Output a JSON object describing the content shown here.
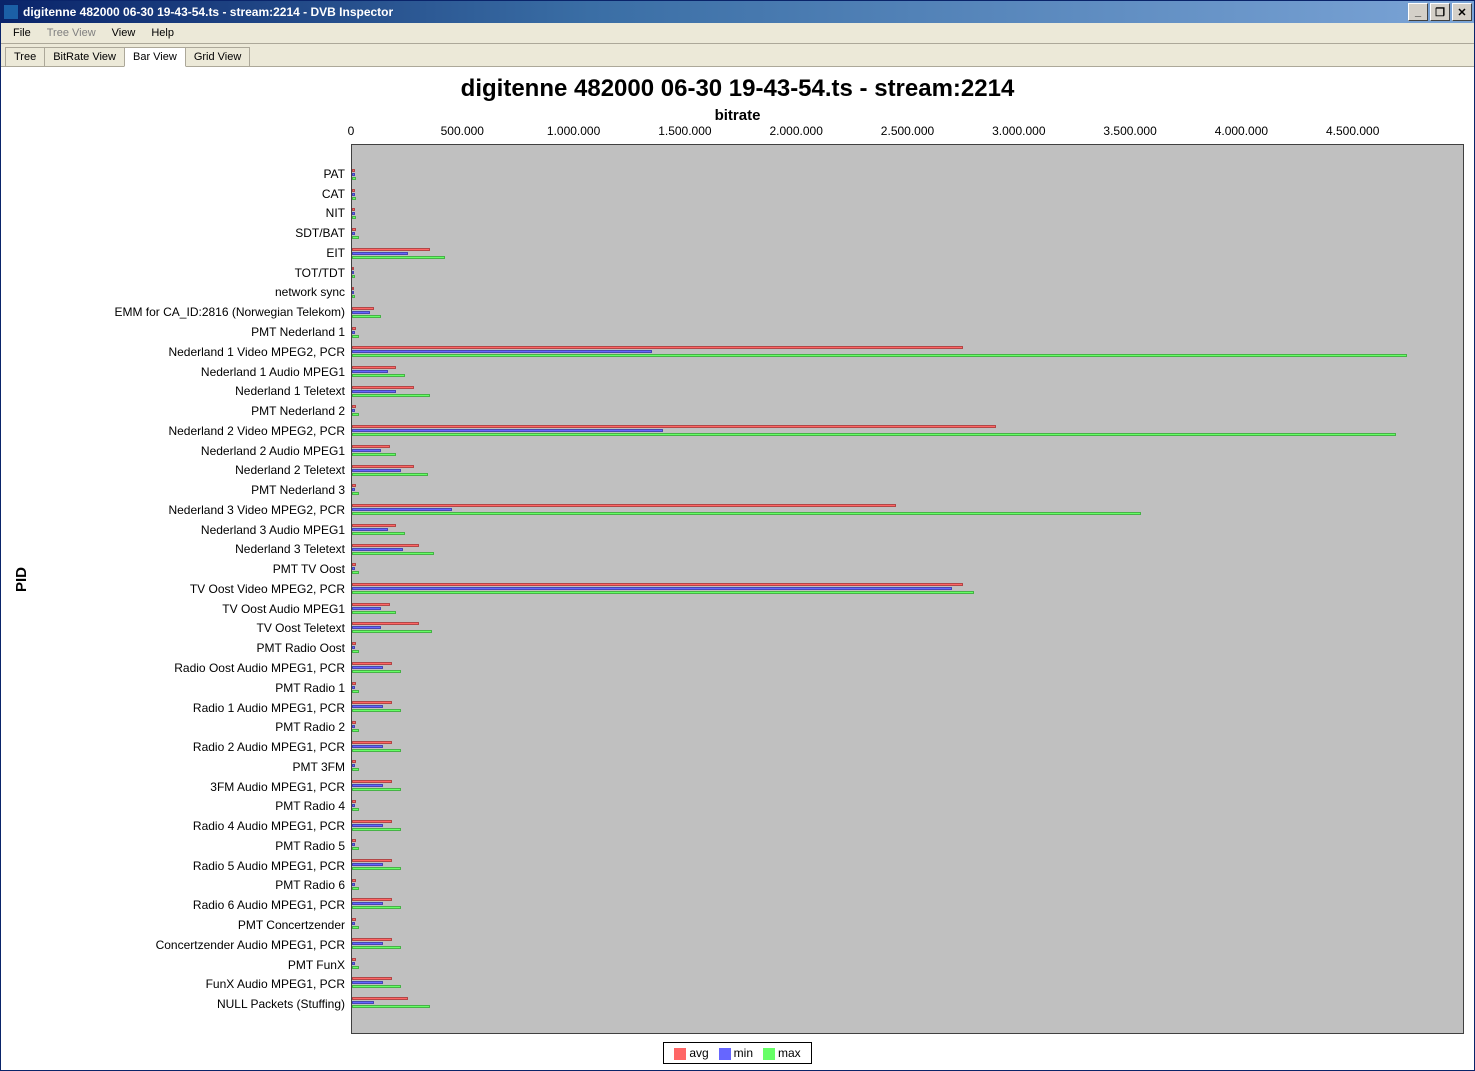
{
  "window": {
    "title": "digitenne 482000 06-30 19-43-54.ts - stream:2214 - DVB Inspector",
    "min": "_",
    "restore": "❐",
    "close": "✕"
  },
  "menu": {
    "items": [
      "File",
      "Tree View",
      "View",
      "Help"
    ],
    "disabled": [
      1
    ]
  },
  "tabs": {
    "items": [
      "Tree",
      "BitRate View",
      "Bar View",
      "Grid View"
    ],
    "active": 2
  },
  "legend": {
    "avg": "avg",
    "min": "min",
    "max": "max"
  },
  "chart_data": {
    "type": "bar",
    "title": "digitenne 482000 06-30 19-43-54.ts - stream:2214",
    "xlabel": "bitrate",
    "ylabel": "PID",
    "xlim": [
      0,
      5000000
    ],
    "xticks": [
      0,
      500000,
      1000000,
      1500000,
      2000000,
      2500000,
      3000000,
      3500000,
      4000000,
      4500000
    ],
    "xtick_labels": [
      "0",
      "500.000",
      "1.000.000",
      "1.500.000",
      "2.000.000",
      "2.500.000",
      "3.000.000",
      "3.500.000",
      "4.000.000",
      "4.500.000"
    ],
    "categories": [
      "PAT",
      "CAT",
      "NIT",
      "SDT/BAT",
      "EIT",
      "TOT/TDT",
      "network sync",
      "EMM for CA_ID:2816 (Norwegian Telekom)",
      "PMT Nederland 1",
      "Nederland 1 Video MPEG2, PCR",
      "Nederland 1 Audio MPEG1",
      "Nederland 1 Teletext",
      "PMT Nederland 2",
      "Nederland 2 Video MPEG2, PCR",
      "Nederland 2 Audio MPEG1",
      "Nederland 2 Teletext",
      "PMT Nederland 3",
      "Nederland 3 Video MPEG2, PCR",
      "Nederland 3 Audio MPEG1",
      "Nederland 3 Teletext",
      "PMT TV Oost",
      "TV Oost Video MPEG2, PCR",
      "TV Oost Audio MPEG1",
      "TV Oost Teletext",
      "PMT Radio Oost",
      "Radio Oost Audio MPEG1, PCR",
      "PMT Radio 1",
      "Radio 1 Audio MPEG1, PCR",
      "PMT Radio 2",
      "Radio 2 Audio MPEG1, PCR",
      "PMT 3FM",
      "3FM Audio MPEG1, PCR",
      "PMT Radio 4",
      "Radio 4 Audio MPEG1, PCR",
      "PMT Radio 5",
      "Radio 5 Audio MPEG1, PCR",
      "PMT Radio 6",
      "Radio 6 Audio MPEG1, PCR",
      "PMT Concertzender",
      "Concertzender Audio MPEG1, PCR",
      "PMT FunX",
      "FunX Audio MPEG1, PCR",
      "NULL Packets (Stuffing)"
    ],
    "series": [
      {
        "name": "avg",
        "color": "#ff6666",
        "values": [
          15000,
          15000,
          15000,
          20000,
          350000,
          10000,
          8000,
          100000,
          20000,
          2750000,
          200000,
          280000,
          20000,
          2900000,
          170000,
          280000,
          20000,
          2450000,
          200000,
          300000,
          20000,
          2750000,
          170000,
          300000,
          20000,
          180000,
          20000,
          180000,
          20000,
          180000,
          20000,
          180000,
          20000,
          180000,
          20000,
          180000,
          20000,
          180000,
          20000,
          180000,
          20000,
          180000,
          250000
        ]
      },
      {
        "name": "min",
        "color": "#6666ff",
        "values": [
          12000,
          12000,
          12000,
          15000,
          250000,
          8000,
          6000,
          80000,
          15000,
          1350000,
          160000,
          200000,
          15000,
          1400000,
          130000,
          220000,
          15000,
          450000,
          160000,
          230000,
          15000,
          2700000,
          130000,
          130000,
          15000,
          140000,
          15000,
          140000,
          15000,
          140000,
          15000,
          140000,
          15000,
          140000,
          15000,
          140000,
          15000,
          140000,
          15000,
          140000,
          15000,
          140000,
          100000
        ]
      },
      {
        "name": "max",
        "color": "#66ff66",
        "values": [
          20000,
          20000,
          20000,
          30000,
          420000,
          15000,
          12000,
          130000,
          30000,
          4750000,
          240000,
          350000,
          30000,
          4700000,
          200000,
          340000,
          30000,
          3550000,
          240000,
          370000,
          30000,
          2800000,
          200000,
          360000,
          30000,
          220000,
          30000,
          220000,
          30000,
          220000,
          30000,
          220000,
          30000,
          220000,
          30000,
          220000,
          30000,
          220000,
          30000,
          220000,
          30000,
          220000,
          350000
        ]
      }
    ]
  }
}
